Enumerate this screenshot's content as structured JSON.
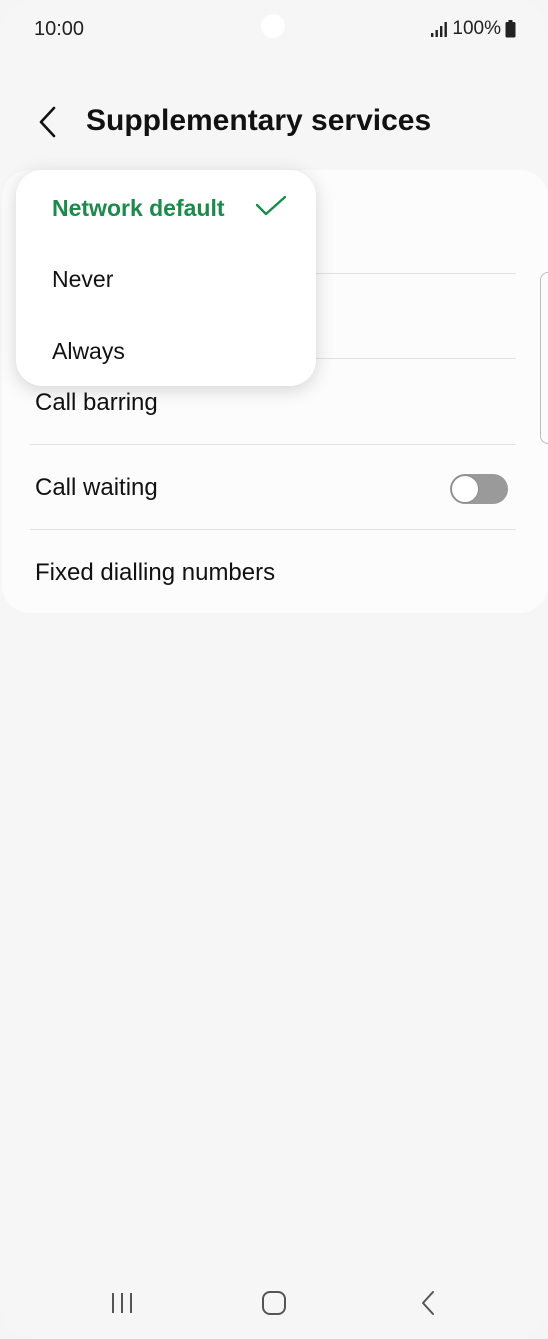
{
  "status_bar": {
    "time": "10:00",
    "battery": "100%",
    "icons": [
      "signal-icon",
      "battery-icon"
    ]
  },
  "header": {
    "title": "Supplementary services",
    "back_icon": "chevron-left-icon"
  },
  "settings": {
    "items": [
      {
        "label": "Call barring"
      },
      {
        "label": "Call waiting",
        "toggle": false
      },
      {
        "label": "Fixed dialling numbers"
      }
    ]
  },
  "dropdown": {
    "options": [
      {
        "label": "Network default",
        "selected": true
      },
      {
        "label": "Never",
        "selected": false
      },
      {
        "label": "Always",
        "selected": false
      }
    ]
  },
  "nav_bar": {
    "icons": [
      "recent-apps-icon",
      "home-icon",
      "back-icon"
    ]
  },
  "colors": {
    "accent": "#1c8a4a",
    "background": "#f6f6f6",
    "card": "#fcfcfc",
    "toggle_off": "#9a9a9a"
  }
}
